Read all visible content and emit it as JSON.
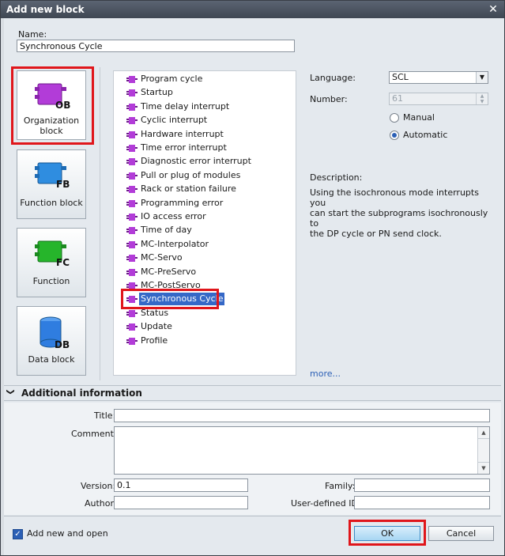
{
  "window": {
    "title": "Add new block",
    "close_glyph": "✕"
  },
  "name": {
    "label": "Name:",
    "value": "Synchronous Cycle"
  },
  "block_types": [
    {
      "id": "ob",
      "tag": "OB",
      "line1": "Organization",
      "line2": "block",
      "color": "#b23cd8",
      "selected": true
    },
    {
      "id": "fb",
      "tag": "FB",
      "line1": "Function block",
      "line2": "",
      "color": "#2f8de0",
      "selected": false
    },
    {
      "id": "fc",
      "tag": "FC",
      "line1": "Function",
      "line2": "",
      "color": "#26b52b",
      "selected": false
    },
    {
      "id": "db",
      "tag": "DB",
      "line1": "Data block",
      "line2": "",
      "color": "#2f7de0",
      "selected": false
    }
  ],
  "ob_list": {
    "items": [
      "Program cycle",
      "Startup",
      "Time delay interrupt",
      "Cyclic interrupt",
      "Hardware interrupt",
      "Time error interrupt",
      "Diagnostic error interrupt",
      "Pull or plug of modules",
      "Rack or station failure",
      "Programming error",
      "IO access error",
      "Time of day",
      "MC-Interpolator",
      "MC-Servo",
      "MC-PreServo",
      "MC-PostServo",
      "Synchronous Cycle",
      "Status",
      "Update",
      "Profile"
    ],
    "selected": "Synchronous Cycle"
  },
  "language": {
    "label": "Language:",
    "value": "SCL",
    "arrow": "▼"
  },
  "number": {
    "label": "Number:",
    "value": "61",
    "up": "▲",
    "down": "▼"
  },
  "numbering": {
    "manual": "Manual",
    "automatic": "Automatic",
    "selected": "Automatic"
  },
  "description": {
    "label": "Description:",
    "line1": "Using the isochronous mode interrupts you",
    "line2": "can start the subprograms isochronously to",
    "line3": "the DP cycle or PN send clock.",
    "more": "more..."
  },
  "additional_info": {
    "header": "Additional  information",
    "chevron": "❯",
    "title_label": "Title:",
    "comment_label": "Comment:",
    "version_label": "Version:",
    "version_value": "0.1",
    "family_label": "Family:",
    "author_label": "Author:",
    "userid_label": "User-defined ID:"
  },
  "footer": {
    "add_new_open": "Add new and open",
    "checked": true,
    "check_glyph": "✓",
    "ok": "OK",
    "cancel": "Cancel"
  },
  "colors": {
    "highlight_red": "#e0161b",
    "selection_blue": "#3568c7",
    "ob_icon": "#b23cd8"
  }
}
